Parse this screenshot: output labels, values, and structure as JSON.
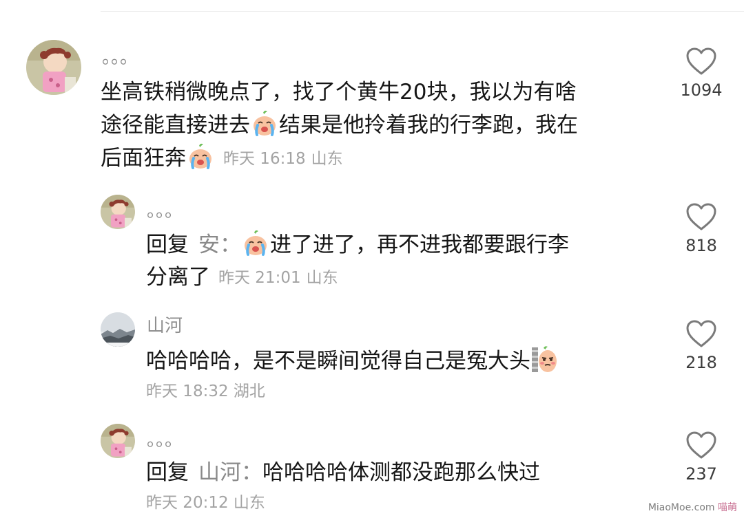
{
  "comments": [
    {
      "username": "。。。",
      "text_lines": [
        "坐高铁稍微晚点了，找了个黄牛20块，我以为有啥",
        "途径能直接进去",
        "结果是他拎着我的行李跑，我在",
        "后面狂奔"
      ],
      "time": "昨天 16:18",
      "region": "山东",
      "likes": "1094"
    },
    {
      "username": "。。。",
      "reply_prefix": "回复",
      "reply_to": "安：",
      "text_lines": [
        "进了进了，再不进我都要跟行李",
        "分离了"
      ],
      "time": "昨天 21:01",
      "region": "山东",
      "likes": "818"
    },
    {
      "username": "山河",
      "text_lines": [
        "哈哈哈哈，是不是瞬间觉得自己是冤大头"
      ],
      "time": "昨天 18:32",
      "region": "湖北",
      "likes": "218"
    },
    {
      "username": "。。。",
      "reply_prefix": "回复",
      "reply_to": "山河：",
      "text_lines": [
        "哈哈哈哈体测都没跑那么快过"
      ],
      "time": "昨天 20:12",
      "region": "山东",
      "likes": "237"
    }
  ],
  "icons": {
    "like": "heart-outline-icon",
    "crying_emoji": "crying-emoji-icon",
    "peeking_emoji": "peeking-emoji-icon"
  },
  "colors": {
    "text": "#161616",
    "meta": "#a3a3a3",
    "username": "#8f8f8f"
  },
  "watermark": {
    "brand": "MiaoMoe.com",
    "cn": "喵萌"
  }
}
